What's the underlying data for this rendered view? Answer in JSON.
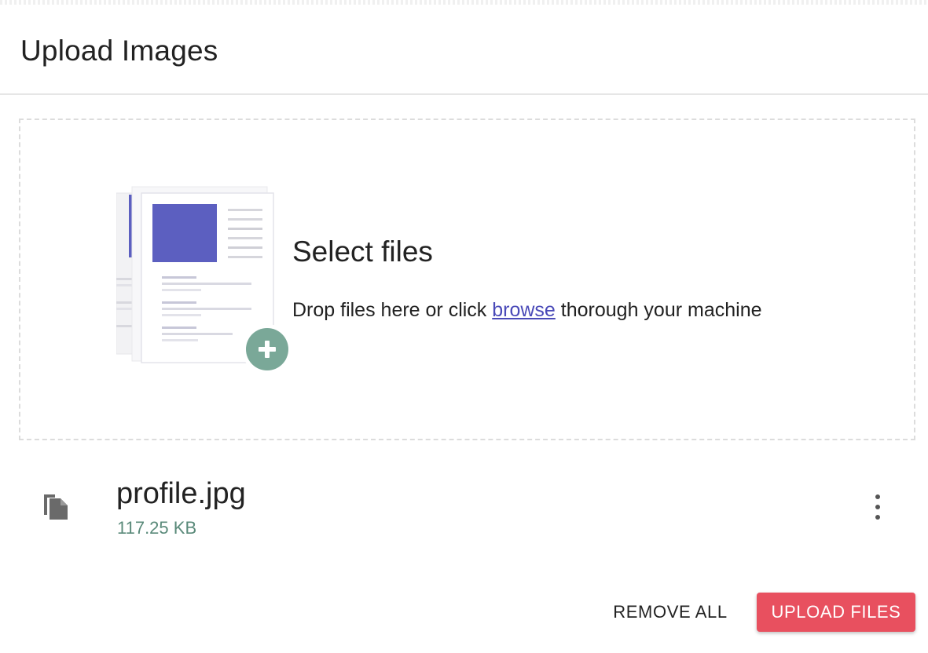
{
  "dialog": {
    "title": "Upload Images"
  },
  "dropzone": {
    "heading": "Select files",
    "text_before_link": "Drop files here or click ",
    "link_text": "browse",
    "text_after_link": " thorough your machine",
    "illustration_icon": "files-add-illustration-icon",
    "accent_color": "#5c5fc0",
    "add_badge_color": "#7aa898"
  },
  "files": [
    {
      "name": "profile.jpg",
      "size": "117.25 KB",
      "icon": "file-copy-icon",
      "menu_icon": "more-vertical-icon"
    }
  ],
  "actions": {
    "remove_all_label": "REMOVE ALL",
    "upload_label": "UPLOAD FILES",
    "upload_color": "#e8505f"
  }
}
